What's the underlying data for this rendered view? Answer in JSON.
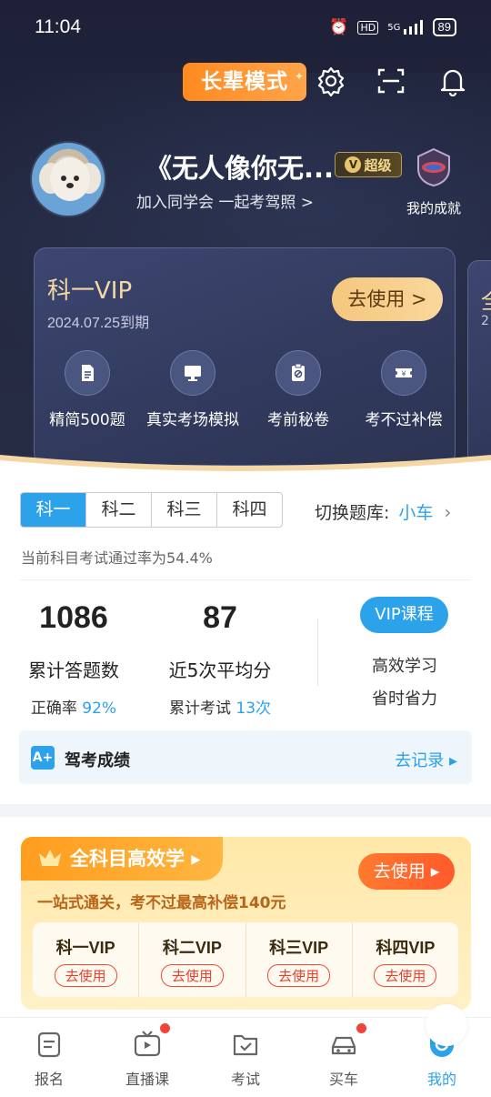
{
  "status_bar": {
    "time": "11:04",
    "network": "5G",
    "battery": "89"
  },
  "header": {
    "elder_mode_label": "长辈模式"
  },
  "profile": {
    "username": "《无人像你无...",
    "vip_level": "超级",
    "join_text": "加入同学会 一起考驾照 >",
    "achievements_label": "我的成就"
  },
  "vip_card": {
    "title": "科一VIP",
    "expire": "2024.07.25到期",
    "use_label": "去使用 >",
    "features": [
      {
        "label": "精简500题",
        "icon": "document-icon"
      },
      {
        "label": "真实考场模拟",
        "icon": "monitor-icon"
      },
      {
        "label": "考前秘卷",
        "icon": "secret-paper-icon"
      },
      {
        "label": "考不过补偿",
        "icon": "coupon-icon"
      }
    ],
    "next_card_title": "全",
    "next_card_sub": "2"
  },
  "subjects": {
    "tabs": [
      "科一",
      "科二",
      "科三",
      "科四"
    ],
    "active_index": 0,
    "switch_label": "切换题库:",
    "switch_value": "小车"
  },
  "pass_rate_text": "当前科目考试通过率为54.4%",
  "stats": {
    "answered": {
      "value": "1086",
      "label": "累计答题数",
      "sub_label": "正确率",
      "sub_value": "92%"
    },
    "avg_score": {
      "value": "87",
      "label": "近5次平均分",
      "sub_label": "累计考试",
      "sub_value": "13次"
    },
    "vip_course": {
      "label": "VIP课程",
      "line1": "高效学习",
      "line2": "省时省力"
    }
  },
  "score_record": {
    "badge": "A+",
    "title": "驾考成绩",
    "action": "去记录 ▸"
  },
  "promo": {
    "tab_label": "全科目高效学 ▸",
    "use_label": "去使用 ▸",
    "subtitle": "一站式通关，考不过最高补偿140元",
    "items": [
      {
        "title": "科一VIP",
        "action": "去使用"
      },
      {
        "title": "科二VIP",
        "action": "去使用"
      },
      {
        "title": "科三VIP",
        "action": "去使用"
      },
      {
        "title": "科四VIP",
        "action": "去使用"
      }
    ]
  },
  "tabbar": {
    "items": [
      {
        "label": "报名",
        "icon": "signup-icon",
        "badge": false
      },
      {
        "label": "直播课",
        "icon": "live-tv-icon",
        "badge": true
      },
      {
        "label": "考试",
        "icon": "exam-check-icon",
        "badge": false
      },
      {
        "label": "买车",
        "icon": "car-icon",
        "badge": true
      },
      {
        "label": "我的",
        "icon": "smile-profile-icon",
        "badge": false
      }
    ],
    "active_index": 4
  },
  "colors": {
    "accent": "#2ba2ea",
    "hero_bg": "#23283f",
    "gold": "#f6d9a2",
    "orange": "#ff9d1e",
    "red": "#f2433a"
  }
}
